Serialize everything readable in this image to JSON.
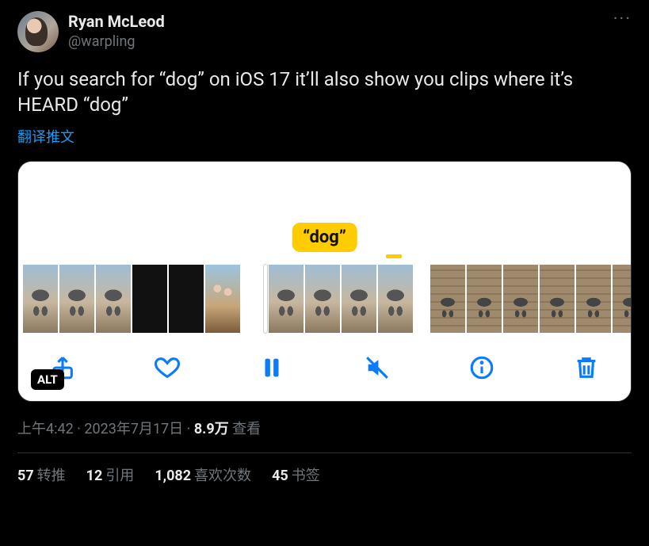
{
  "author": {
    "display_name": "Ryan McLeod",
    "handle": "@warpling"
  },
  "text": "If you search for “dog” on iOS 17 it’ll also show you clips where it’s HEARD “dog”",
  "translate_label": "翻译推文",
  "media": {
    "search_tag": "“dog”",
    "alt_badge": "ALT"
  },
  "meta": {
    "time": "上午4:42",
    "dot1": " · ",
    "date": "2023年7月17日",
    "dot2": " · ",
    "views_count": "8.9万",
    "views_label": " 查看"
  },
  "engagement": {
    "retweets": {
      "count": "57",
      "label": "转推"
    },
    "quotes": {
      "count": "12",
      "label": "引用"
    },
    "likes": {
      "count": "1,082",
      "label": "喜欢次数"
    },
    "bookmarks": {
      "count": "45",
      "label": "书签"
    }
  }
}
